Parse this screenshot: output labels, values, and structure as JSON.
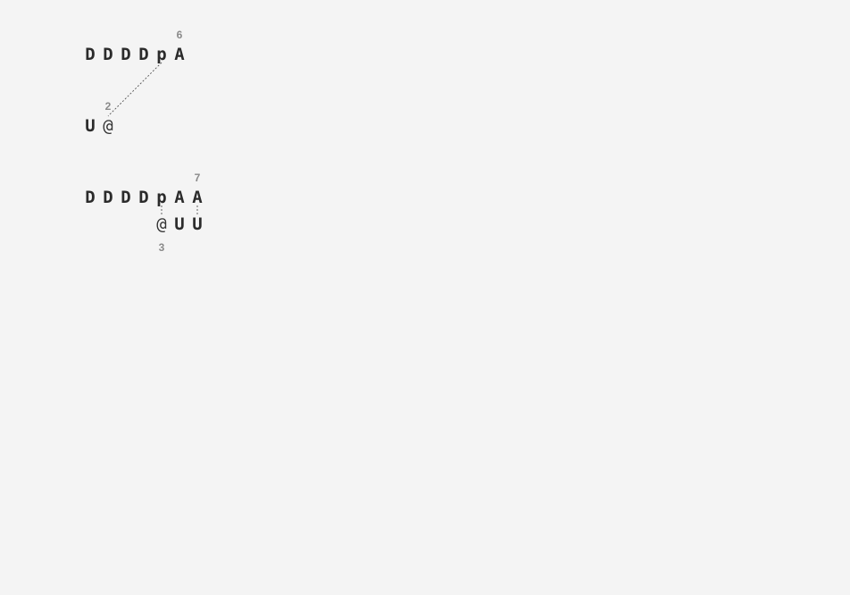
{
  "block1": {
    "seq_top": [
      "D",
      "D",
      "D",
      "D",
      "p",
      "A"
    ],
    "top_index": "6",
    "seq_bottom": [
      "U",
      "@"
    ],
    "bottom_index": "2"
  },
  "block2": {
    "seq_top": [
      "D",
      "D",
      "D",
      "D",
      "p",
      "A",
      "A"
    ],
    "top_index": "7",
    "seq_bottom": [
      "@",
      "U",
      "U"
    ],
    "bottom_index": "3"
  },
  "colors": {
    "background": "#f4f4f4",
    "glyph": "#2b2b2b",
    "index": "#8a8a8a",
    "link": "#555555"
  }
}
